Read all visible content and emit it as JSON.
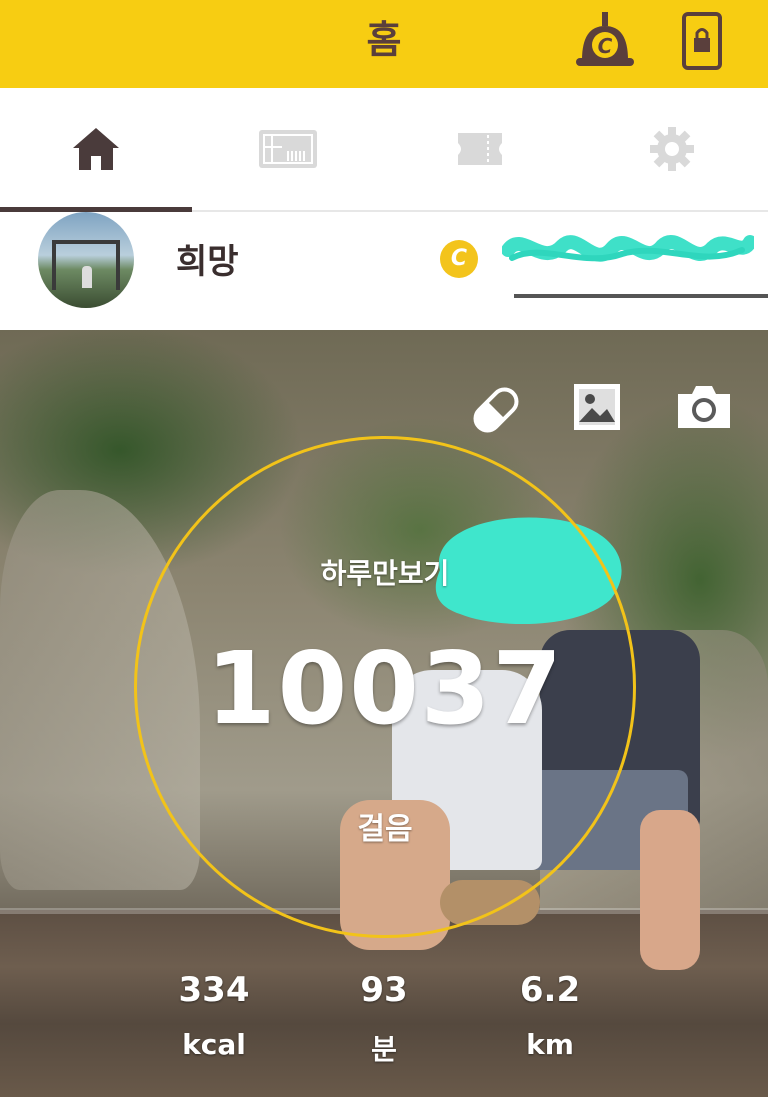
{
  "header": {
    "title": "홈",
    "coin_icon": "coin-badge-icon",
    "lock_icon": "phone-lock-icon",
    "background": "#f7cd12",
    "title_color": "#5a3f3c"
  },
  "tabs": [
    {
      "icon": "home-icon",
      "active": true
    },
    {
      "icon": "gift-card-icon",
      "active": false
    },
    {
      "icon": "ticket-icon",
      "active": false
    },
    {
      "icon": "gear-icon",
      "active": false
    }
  ],
  "profile": {
    "name": "희망",
    "coin_symbol": "C"
  },
  "hero": {
    "actions": [
      {
        "icon": "pill-icon"
      },
      {
        "icon": "gallery-icon"
      },
      {
        "icon": "camera-icon"
      }
    ],
    "goal_label": "하루만보기",
    "steps": "10037",
    "steps_unit": "걸음",
    "ring_color": "#f2c319"
  },
  "stats": [
    {
      "value": "334",
      "unit": "kcal"
    },
    {
      "value": "93",
      "unit": "분"
    },
    {
      "value": "6.2",
      "unit": "km"
    }
  ]
}
